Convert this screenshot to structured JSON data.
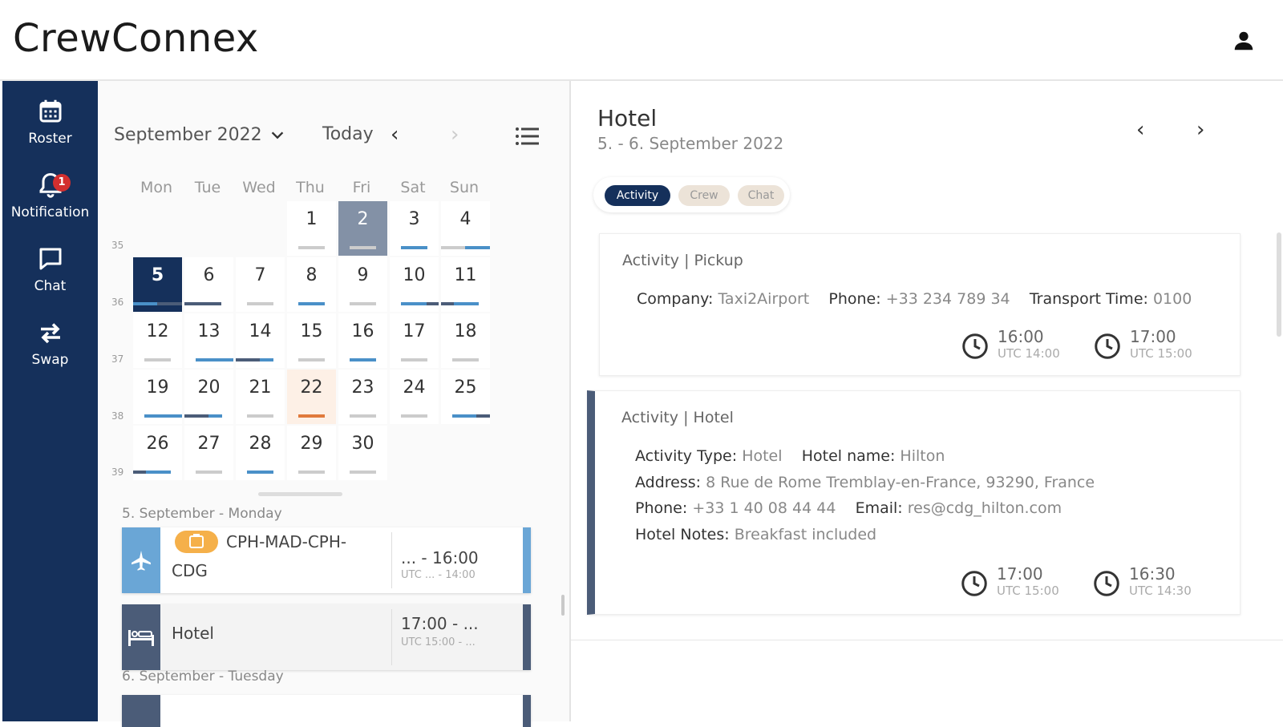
{
  "app": {
    "title": "CrewConnex"
  },
  "icons": {
    "user": "person-icon",
    "roster": "calendar-icon",
    "notification": "bell-icon",
    "chat": "chat-bubble-icon",
    "swap": "swap-arrows-icon",
    "list": "list-icon",
    "clock": "clock-icon",
    "flight": "airplane-icon",
    "hotel": "bed-icon"
  },
  "colors": {
    "navy": "#15305b",
    "accent_blue": "#4a90c8",
    "today": "#e07a3c",
    "badge": "#d32f2f"
  },
  "sidebar": {
    "items": [
      {
        "label": "Roster"
      },
      {
        "label": "Notification",
        "badge": "1"
      },
      {
        "label": "Chat"
      },
      {
        "label": "Swap"
      }
    ]
  },
  "calendar": {
    "month": "September 2022",
    "today_label": "Today",
    "prev": "‹",
    "next": "›",
    "weekdays": [
      "Mon",
      "Tue",
      "Wed",
      "Thu",
      "Fri",
      "Sat",
      "Sun"
    ],
    "week_numbers": [
      "35",
      "36",
      "37",
      "38",
      "39"
    ],
    "selected_day": "5",
    "today_day": "22",
    "days": [
      "1",
      "2",
      "3",
      "4",
      "5",
      "6",
      "7",
      "8",
      "9",
      "10",
      "11",
      "12",
      "13",
      "14",
      "15",
      "16",
      "17",
      "18",
      "19",
      "20",
      "21",
      "22",
      "23",
      "24",
      "25",
      "26",
      "27",
      "28",
      "29",
      "30"
    ]
  },
  "agenda": {
    "day1_label": "5. September - Monday",
    "flight": {
      "title_line1": "CPH-MAD-CPH-",
      "title_line2": "CDG",
      "time": "... - 16:00",
      "utc": "UTC ... - 14:00"
    },
    "hotel": {
      "title": "Hotel",
      "time": "17:00 - ...",
      "utc": "UTC 15:00 - ..."
    },
    "day2_label": "6. September - Tuesday"
  },
  "detail": {
    "title": "Hotel",
    "subtitle": "5. - 6. September 2022",
    "prev": "‹",
    "next": "›",
    "tabs": [
      "Activity",
      "Crew",
      "Chat"
    ],
    "pickup": {
      "header_prefix": "Activity | ",
      "header_main": "Pickup",
      "company_label": "Company:",
      "company": "Taxi2Airport",
      "phone_label": "Phone:",
      "phone": "+33 234 789 34",
      "transport_label": "Transport Time:",
      "transport": "0100",
      "start_time": "16:00",
      "start_utc": "UTC 14:00",
      "end_time": "17:00",
      "end_utc": "UTC 15:00"
    },
    "hotel": {
      "header_prefix": "Activity | ",
      "header_main": "Hotel",
      "type_label": "Activity Type:",
      "type": "Hotel",
      "name_label": "Hotel name:",
      "name": "Hilton",
      "address_label": "Address:",
      "address": "8 Rue de Rome Tremblay-en-France, 93290, France",
      "phone_label": "Phone:",
      "phone": "+33 1 40 08 44 44",
      "email_label": "Email:",
      "email": "res@cdg_hilton.com",
      "notes_label": "Hotel Notes:",
      "notes": "Breakfast included",
      "start_time": "17:00",
      "start_utc": "UTC 15:00",
      "end_time": "16:30",
      "end_utc": "UTC 14:30"
    }
  }
}
